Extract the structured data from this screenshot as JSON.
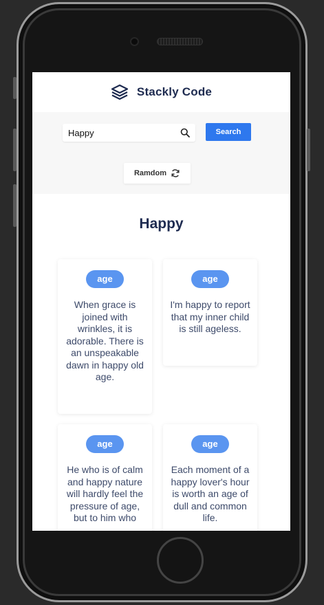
{
  "header": {
    "brand": "Stackly Code",
    "logo_icon": "layers-icon"
  },
  "search": {
    "value": "Happy",
    "button_label": "Search",
    "icon": "search-icon"
  },
  "random": {
    "label": "Ramdom",
    "icon": "refresh-icon"
  },
  "result_heading": "Happy",
  "quotes": [
    {
      "tag": "age",
      "text": "When grace is joined with wrinkles, it is adorable. There is an unspeakable dawn in happy old age."
    },
    {
      "tag": "age",
      "text": "I'm happy to report that my inner child is still ageless."
    },
    {
      "tag": "age",
      "text": "He who is of calm and happy nature will hardly feel the pressure of age, but to him who"
    },
    {
      "tag": "age",
      "text": "Each moment of a happy lover's hour is worth an age of dull and common life."
    }
  ],
  "colors": {
    "brand_text": "#1e2b50",
    "accent": "#2e78ee",
    "tag": "#5a95f0",
    "band": "#f7f7f7"
  }
}
